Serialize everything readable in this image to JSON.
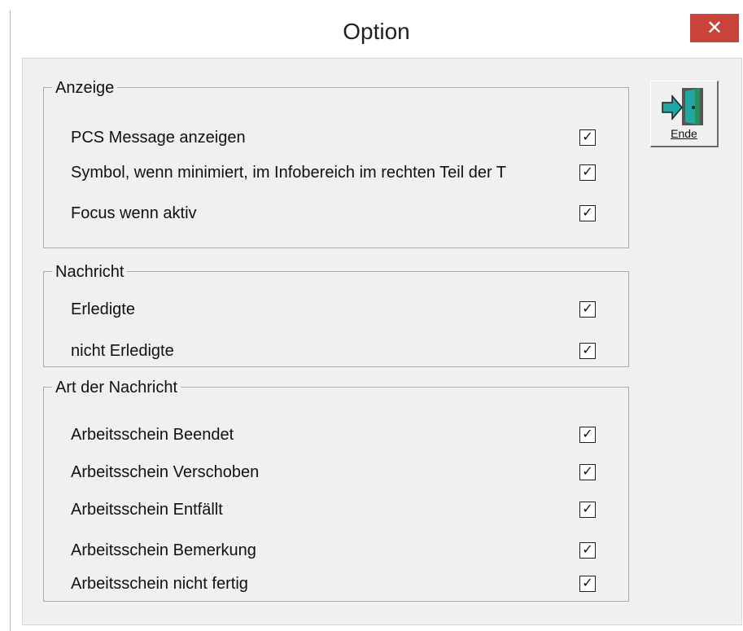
{
  "window": {
    "title": "Option",
    "close_glyph": "✕"
  },
  "toolbar": {
    "exit_label": "Ende",
    "exit_icon": "exit-door-icon"
  },
  "groups": [
    {
      "legend": "Anzeige",
      "items": [
        {
          "label": "PCS Message anzeigen",
          "checked": true
        },
        {
          "label": "Symbol, wenn minimiert, im Infobereich im rechten Teil der T",
          "checked": true
        },
        {
          "label": "Focus wenn aktiv",
          "checked": true
        }
      ]
    },
    {
      "legend": "Nachricht",
      "items": [
        {
          "label": "Erledigte",
          "checked": true
        },
        {
          "label": "nicht Erledigte",
          "checked": true
        }
      ]
    },
    {
      "legend": "Art der Nachricht",
      "items": [
        {
          "label": "Arbeitsschein Beendet",
          "checked": true
        },
        {
          "label": "Arbeitsschein Verschoben",
          "checked": true
        },
        {
          "label": "Arbeitsschein Entfällt",
          "checked": true
        },
        {
          "label": "Arbeitsschein Bemerkung",
          "checked": true
        },
        {
          "label": "Arbeitsschein nicht fertig",
          "checked": true
        }
      ]
    }
  ],
  "checkbox_glyph": "✓",
  "colors": {
    "close_button": "#c9433a",
    "client_background": "#f0f0f0",
    "door_teal": "#1fa7a4",
    "door_green": "#2c8f5a"
  }
}
